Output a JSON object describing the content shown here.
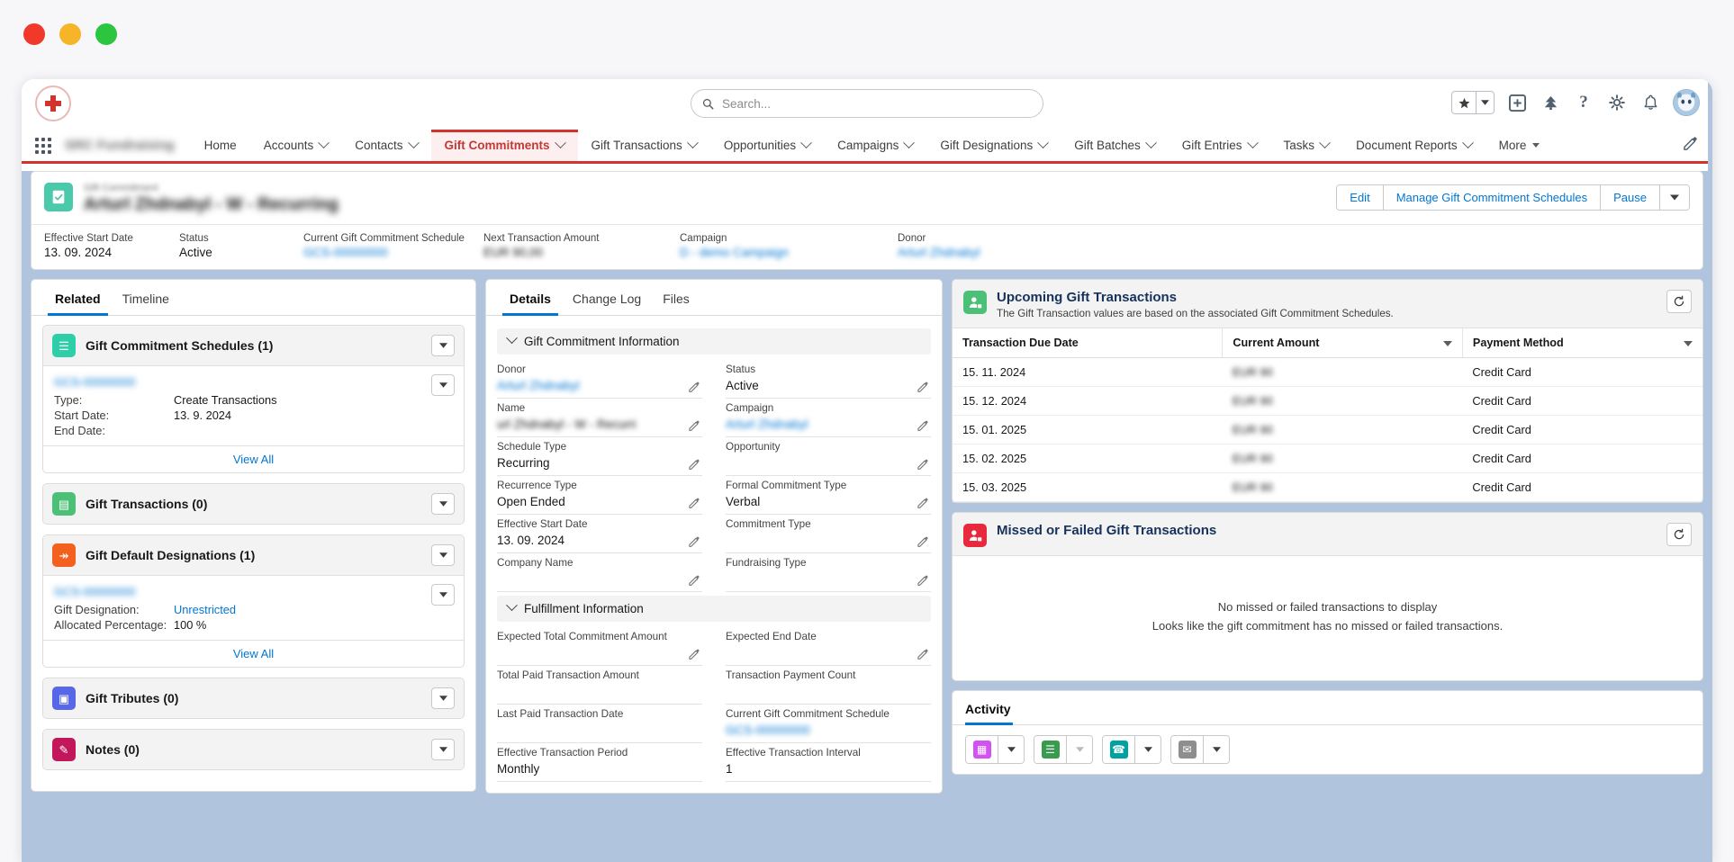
{
  "global_header": {
    "logo_icon": "red-cross-logo",
    "search": {
      "placeholder": "Search...",
      "value": "",
      "icon": "search-icon"
    },
    "icons": [
      {
        "name": "favorites-star-icon",
        "glyph": "★"
      },
      {
        "name": "favorites-dropdown-icon",
        "glyph": "▼"
      },
      {
        "name": "add-icon",
        "glyph": "+"
      },
      {
        "name": "setup-tree-icon",
        "glyph": "⸙"
      },
      {
        "name": "help-icon",
        "glyph": "?"
      },
      {
        "name": "settings-gear-icon",
        "glyph": "⚙"
      },
      {
        "name": "notifications-bell-icon",
        "glyph": "🔔"
      },
      {
        "name": "user-avatar",
        "glyph": ""
      }
    ]
  },
  "app_nav": {
    "app_launcher_label": "app-launcher",
    "app_name": "SRC Fundraising",
    "items": [
      {
        "label": "Home",
        "has_menu": false,
        "active": false
      },
      {
        "label": "Accounts",
        "has_menu": true,
        "active": false
      },
      {
        "label": "Contacts",
        "has_menu": true,
        "active": false
      },
      {
        "label": "Gift Commitments",
        "has_menu": true,
        "active": true
      },
      {
        "label": "Gift Transactions",
        "has_menu": true,
        "active": false
      },
      {
        "label": "Opportunities",
        "has_menu": true,
        "active": false
      },
      {
        "label": "Campaigns",
        "has_menu": true,
        "active": false
      },
      {
        "label": "Gift Designations",
        "has_menu": true,
        "active": false
      },
      {
        "label": "Gift Batches",
        "has_menu": true,
        "active": false
      },
      {
        "label": "Gift Entries",
        "has_menu": true,
        "active": false
      },
      {
        "label": "Tasks",
        "has_menu": true,
        "active": false
      },
      {
        "label": "Document Reports",
        "has_menu": true,
        "active": false
      },
      {
        "label": "More",
        "has_menu": true,
        "active": false
      }
    ],
    "edit_nav_icon": "pencil-icon",
    "accent_color": "#d0342c"
  },
  "record_header": {
    "object_label": "Gift Commitment",
    "record_title": "Arturl Zhdnabyl - W - Recurring",
    "icon_color": "#4bc9ab",
    "buttons": [
      {
        "label": "Edit",
        "name": "edit-button"
      },
      {
        "label": "Manage Gift Commitment Schedules",
        "name": "manage-gift-commitment-schedules-button"
      },
      {
        "label": "Pause",
        "name": "pause-button"
      }
    ],
    "fields": [
      {
        "label": "Effective Start Date",
        "value": "13. 09. 2024",
        "redacted": false,
        "link": false
      },
      {
        "label": "Status",
        "value": "Active",
        "redacted": false,
        "link": false
      },
      {
        "label": "Current Gift Commitment Schedule",
        "value": "GCS-00000000",
        "redacted": true,
        "link": true
      },
      {
        "label": "Next Transaction Amount",
        "value": "EUR 90,00",
        "redacted": true,
        "link": false
      },
      {
        "label": "Campaign",
        "value": "D - demo Campaign",
        "redacted": true,
        "link": true
      },
      {
        "label": "Donor",
        "value": "Arturl Zhdnabyl",
        "redacted": true,
        "link": true
      }
    ]
  },
  "left_panel": {
    "tabs": [
      {
        "label": "Related",
        "active": true
      },
      {
        "label": "Timeline",
        "active": false
      }
    ],
    "related_lists": [
      {
        "title": "Gift Commitment Schedules (1)",
        "icon_color": "#2ecfa8",
        "icon_glyph": "☰",
        "has_rows": true,
        "record_name": "GCS-00000000",
        "rows": [
          {
            "key": "Type:",
            "value": "Create Transactions",
            "link": false
          },
          {
            "key": "Start Date:",
            "value": "13. 9. 2024",
            "link": false
          },
          {
            "key": "End Date:",
            "value": "",
            "link": false
          }
        ],
        "footer": "View All"
      },
      {
        "title": "Gift Transactions (0)",
        "icon_color": "#4bc076",
        "icon_glyph": "▤",
        "has_rows": false,
        "rows": [],
        "footer": ""
      },
      {
        "title": "Gift Default Designations (1)",
        "icon_color": "#f4601e",
        "icon_glyph": "↠",
        "has_rows": true,
        "record_name": "GCS-00000000",
        "rows": [
          {
            "key": "Gift Designation:",
            "value": "Unrestricted",
            "link": true
          },
          {
            "key": "Allocated Percentage:",
            "value": "100 %",
            "link": false
          }
        ],
        "footer": "View All"
      },
      {
        "title": "Gift Tributes (0)",
        "icon_color": "#5867e8",
        "icon_glyph": "▣",
        "has_rows": false,
        "rows": [],
        "footer": ""
      },
      {
        "title": "Notes (0)",
        "icon_color": "#c2185b",
        "icon_glyph": "✎",
        "has_rows": false,
        "rows": [],
        "footer": ""
      }
    ]
  },
  "details_panel": {
    "tabs": [
      {
        "label": "Details",
        "active": true
      },
      {
        "label": "Change Log",
        "active": false
      },
      {
        "label": "Files",
        "active": false
      }
    ],
    "sections": [
      {
        "title": "Gift Commitment Information",
        "left_fields": [
          {
            "label": "Donor",
            "value": "Arturl Zhdnabyl",
            "redacted": true,
            "link": true,
            "editable": true
          },
          {
            "label": "Name",
            "value": "url Zhdnabyl - W - Recurri",
            "redacted": true,
            "link": false,
            "editable": true
          },
          {
            "label": "Schedule Type",
            "value": "Recurring",
            "redacted": false,
            "link": false,
            "editable": true
          },
          {
            "label": "Recurrence Type",
            "value": "Open Ended",
            "redacted": false,
            "link": false,
            "editable": true
          },
          {
            "label": "Effective Start Date",
            "value": "13. 09. 2024",
            "redacted": false,
            "link": false,
            "editable": true
          },
          {
            "label": "Company Name",
            "value": "",
            "redacted": false,
            "link": false,
            "editable": true
          }
        ],
        "right_fields": [
          {
            "label": "Status",
            "value": "Active",
            "redacted": false,
            "link": false,
            "editable": true
          },
          {
            "label": "Campaign",
            "value": "Arturl Zhdnabyl",
            "redacted": true,
            "link": true,
            "editable": true
          },
          {
            "label": "Opportunity",
            "value": "",
            "redacted": false,
            "link": false,
            "editable": true
          },
          {
            "label": "Formal Commitment Type",
            "value": "Verbal",
            "redacted": false,
            "link": false,
            "editable": true
          },
          {
            "label": "Commitment Type",
            "value": "",
            "redacted": false,
            "link": false,
            "editable": true
          },
          {
            "label": "Fundraising Type",
            "value": "",
            "redacted": false,
            "link": false,
            "editable": true
          }
        ]
      },
      {
        "title": "Fulfillment Information",
        "left_fields": [
          {
            "label": "Expected Total Commitment Amount",
            "value": "",
            "redacted": false,
            "link": false,
            "editable": true
          },
          {
            "label": "Total Paid Transaction Amount",
            "value": "",
            "redacted": false,
            "link": false,
            "editable": false
          },
          {
            "label": "Last Paid Transaction Date",
            "value": "",
            "redacted": false,
            "link": false,
            "editable": false
          },
          {
            "label": "Effective Transaction Period",
            "value": "Monthly",
            "redacted": false,
            "link": false,
            "editable": false
          }
        ],
        "right_fields": [
          {
            "label": "Expected End Date",
            "value": "",
            "redacted": false,
            "link": false,
            "editable": true
          },
          {
            "label": "Transaction Payment Count",
            "value": "",
            "redacted": false,
            "link": false,
            "editable": false
          },
          {
            "label": "Current Gift Commitment Schedule",
            "value": "GCS-00000000",
            "redacted": true,
            "link": true,
            "editable": false
          },
          {
            "label": "Effective Transaction Interval",
            "value": "1",
            "redacted": false,
            "link": false,
            "editable": false
          }
        ]
      }
    ]
  },
  "right_panel": {
    "upcoming": {
      "title": "Upcoming Gift Transactions",
      "subtitle": "The Gift Transaction values are based on the associated Gift Commitment Schedules.",
      "icon_color": "#4bc076",
      "refresh_icon": "refresh-icon",
      "columns": [
        "Transaction Due Date",
        "Current Amount",
        "Payment Method"
      ],
      "rows": [
        {
          "due_date": "15. 11. 2024",
          "amount": "EUR 90",
          "amount_redacted": true,
          "payment_method": "Credit Card"
        },
        {
          "due_date": "15. 12. 2024",
          "amount": "EUR 90",
          "amount_redacted": true,
          "payment_method": "Credit Card"
        },
        {
          "due_date": "15. 01. 2025",
          "amount": "EUR 90",
          "amount_redacted": true,
          "payment_method": "Credit Card"
        },
        {
          "due_date": "15. 02. 2025",
          "amount": "EUR 90",
          "amount_redacted": true,
          "payment_method": "Credit Card"
        },
        {
          "due_date": "15. 03. 2025",
          "amount": "EUR 90",
          "amount_redacted": true,
          "payment_method": "Credit Card"
        }
      ]
    },
    "missed": {
      "title": "Missed or Failed Gift Transactions",
      "icon_color": "#e8283c",
      "refresh_icon": "refresh-icon",
      "empty_line1": "No missed or failed transactions to display",
      "empty_line2": "Looks like the gift commitment has no missed or failed transactions."
    },
    "activity": {
      "tab_label": "Activity",
      "buttons": [
        {
          "name": "new-event-button",
          "icon": "calendar-icon",
          "color": "#d152f0",
          "glyph": "▦",
          "caret_enabled": true
        },
        {
          "name": "new-task-button",
          "icon": "task-list-icon",
          "color": "#3a9b4e",
          "glyph": "☰",
          "caret_enabled": false
        },
        {
          "name": "log-a-call-button",
          "icon": "phone-log-icon",
          "color": "#00a1a1",
          "glyph": "☎",
          "caret_enabled": true
        },
        {
          "name": "email-button",
          "icon": "email-icon",
          "color": "#8e8e8e",
          "glyph": "✉",
          "caret_enabled": true
        }
      ]
    }
  }
}
